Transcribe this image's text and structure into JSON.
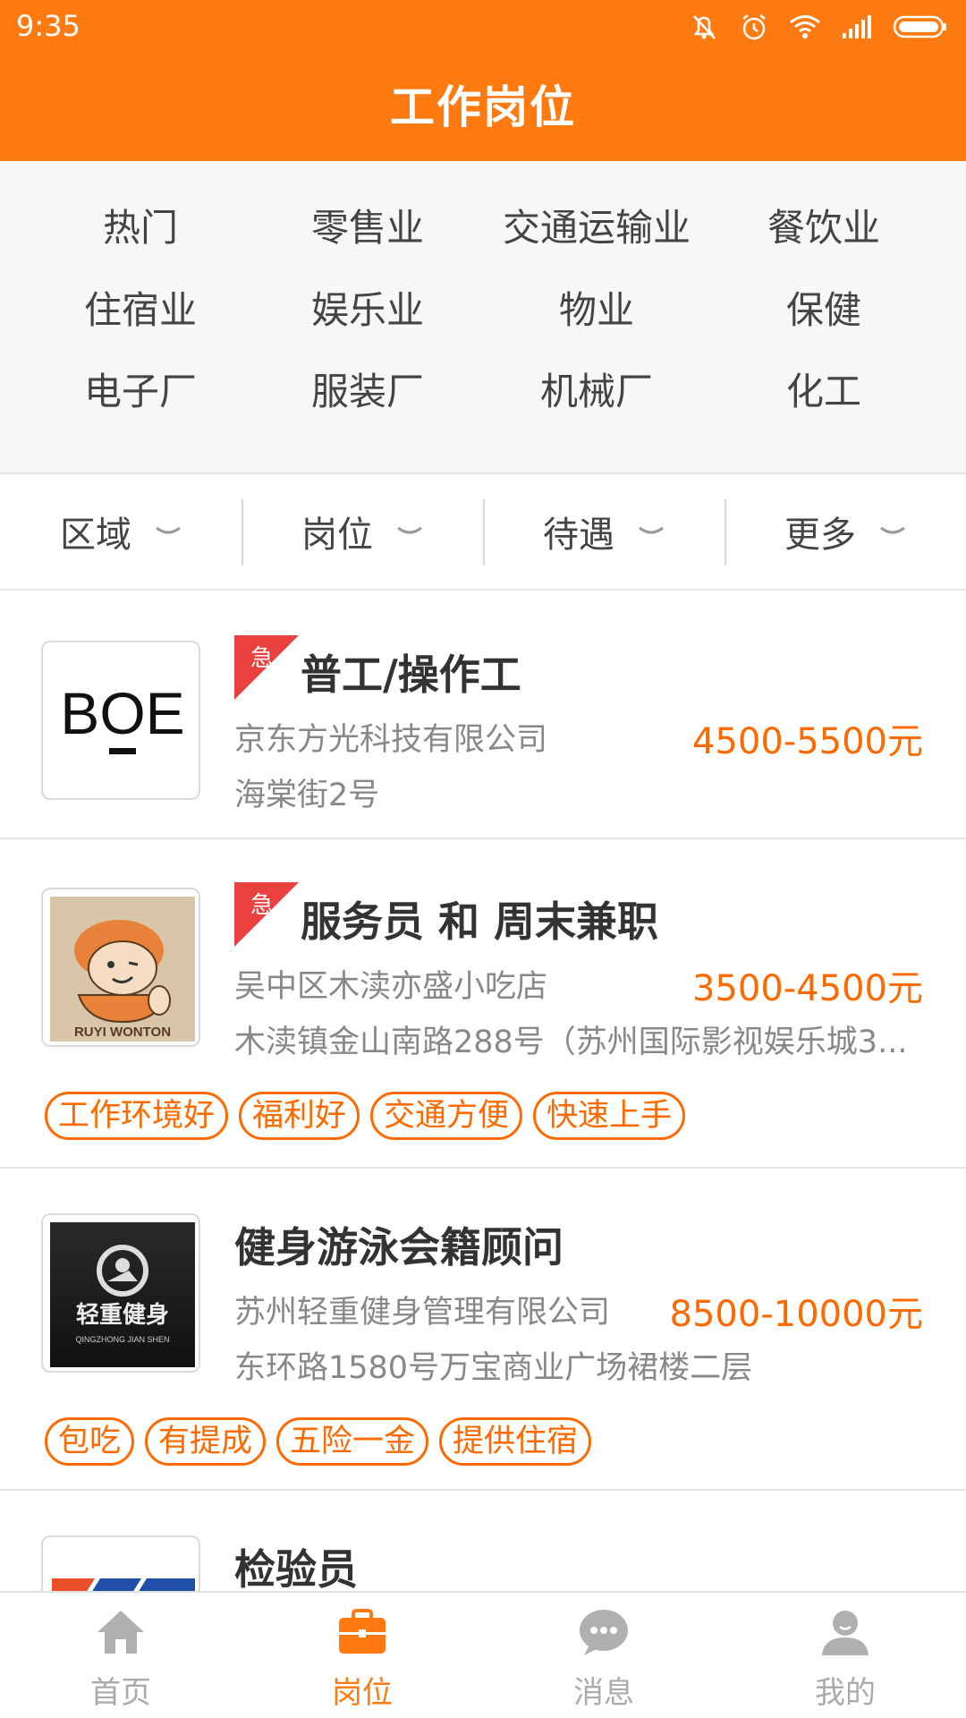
{
  "status_bar": {
    "time": "9:35"
  },
  "header": {
    "title": "工作岗位"
  },
  "categories": [
    "热门",
    "零售业",
    "交通运输业",
    "餐饮业",
    "住宿业",
    "娱乐业",
    "物业",
    "保健",
    "电子厂",
    "服装厂",
    "机械厂",
    "化工"
  ],
  "filters": [
    "区域",
    "岗位",
    "待遇",
    "更多"
  ],
  "jobs": [
    {
      "urgent": true,
      "urgent_label": "急",
      "title": "普工/操作工",
      "company": "京东方光科技有限公司",
      "salary": "4500-5500元",
      "address": "海棠街2号",
      "logo_text": "BOE",
      "tags": []
    },
    {
      "urgent": true,
      "urgent_label": "急",
      "title": "服务员 和 周末兼职",
      "company": "吴中区木渎亦盛小吃店",
      "salary": "3500-4500元",
      "address": "木渎镇金山南路288号（苏州国际影视娱乐城3...",
      "logo_text": "RUYI WONTON",
      "tags": [
        "工作环境好",
        "福利好",
        "交通方便",
        "快速上手"
      ]
    },
    {
      "urgent": false,
      "title": "健身游泳会籍顾问",
      "company": "苏州轻重健身管理有限公司",
      "salary": "8500-10000元",
      "address": "东环路1580号万宝商业广场裙楼二层",
      "logo_text": "轻重健身",
      "logo_subtext": "QINGZHONG JIAN SHEN",
      "tags": [
        "包吃",
        "有提成",
        "五险一金",
        "提供住宿"
      ]
    },
    {
      "urgent": false,
      "title": "检验员",
      "tags": []
    }
  ],
  "bottom_nav": [
    {
      "label": "首页",
      "icon": "home-icon",
      "active": false
    },
    {
      "label": "岗位",
      "icon": "briefcase-icon",
      "active": true
    },
    {
      "label": "消息",
      "icon": "message-icon",
      "active": false
    },
    {
      "label": "我的",
      "icon": "user-icon",
      "active": false
    }
  ],
  "colors": {
    "primary": "#FF7A10",
    "salary": "#FF6A00",
    "urgent": "#E8413F",
    "inactive": "#AAAAAA"
  }
}
